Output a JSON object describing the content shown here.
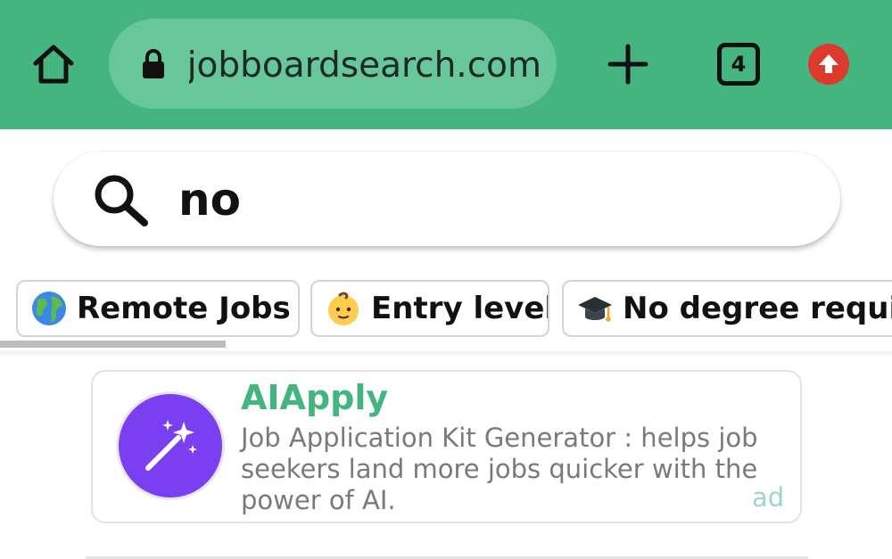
{
  "browser": {
    "url": "jobboardsearch.com",
    "tab_count": "4",
    "colors": {
      "toolbar": "#44b57f",
      "url_pill": "#68c79a",
      "update_badge": "#db3a2c"
    },
    "icons": [
      "home-icon",
      "lock-icon",
      "plus-icon",
      "tab-switcher-icon",
      "update-arrow-icon"
    ]
  },
  "search": {
    "value": "no",
    "icon": "search-icon"
  },
  "filters": [
    {
      "emoji": "globe-emoji",
      "label": "Remote Jobs"
    },
    {
      "emoji": "baby-emoji",
      "label": "Entry level"
    },
    {
      "emoji": "graduation-cap-emoji",
      "label": "No degree required"
    }
  ],
  "ad": {
    "title": "AIApply",
    "description": "Job Application Kit Generator : helps job seekers land more jobs quicker with the power of AI.",
    "tag": "ad",
    "logo_icon": "magic-wand-icon",
    "colors": {
      "title": "#44b57f",
      "logo_bg": "#7b3ff2"
    }
  }
}
